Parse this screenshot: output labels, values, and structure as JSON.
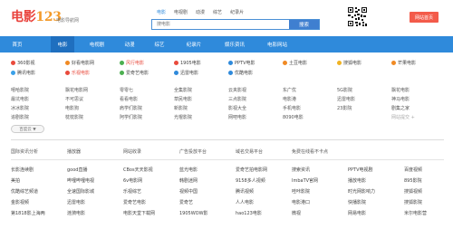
{
  "colors": {
    "brand_red": "#e9423c",
    "brand_orange": "#f39a2a",
    "nav_blue": "#2f8adb",
    "nav_active": "#1f6fbf",
    "search_btn": "#3f7fd0",
    "home_btn": "#f35b4a"
  },
  "header": {
    "logo_text": "电影",
    "logo_num": "123",
    "slogan": "电影导航网",
    "search_tabs": [
      "电影",
      "电视剧",
      "动漫",
      "综艺",
      "纪录片"
    ],
    "search_placeholder": "搜电影",
    "search_button": "搜索",
    "qr_icon": "qr-code-icon",
    "home_button": "网站首页"
  },
  "nav": {
    "items": [
      "首页",
      "电影",
      "电视剧",
      "动漫",
      "综艺",
      "纪录片",
      "娱乐资讯",
      "电影网站"
    ]
  },
  "featured": {
    "rows": [
      [
        {
          "label": "360影视",
          "icon": "#e94a3c",
          "style": ""
        },
        {
          "label": "好看电影网",
          "icon": "#f08a24",
          "style": ""
        },
        {
          "label": "风行电影",
          "icon": "#4caf50",
          "style": "hl"
        },
        {
          "label": "1905电影",
          "icon": "#e94a3c",
          "style": ""
        },
        {
          "label": "PPTV电影",
          "icon": "#2f8adb",
          "style": ""
        },
        {
          "label": "土豆电影",
          "icon": "#f08a24",
          "style": ""
        },
        {
          "label": "搜狐电影",
          "icon": "#f0b323",
          "style": ""
        },
        {
          "label": "芒果电影",
          "icon": "#f08a24",
          "style": ""
        }
      ],
      [
        {
          "label": "腾讯电影",
          "icon": "#3aa0e8",
          "style": ""
        },
        {
          "label": "乐视电影",
          "icon": "#e94a3c",
          "style": "hl"
        },
        {
          "label": "爱奇艺电影",
          "icon": "#4caf50",
          "style": ""
        },
        {
          "label": "迅雷电影",
          "icon": "#2f8adb",
          "style": ""
        },
        {
          "label": "优酷电影",
          "icon": "#2f8adb",
          "style": ""
        }
      ]
    ],
    "grid": [
      [
        "嘻哈影院",
        "飘花电影网",
        "零零七",
        "全集影院",
        "云夹影视",
        "东广优",
        "5G影院",
        "飘花电影"
      ],
      [
        "最坑电影",
        "不可思议",
        "看看电影",
        "草民电影",
        "三点影院",
        "电影港",
        "迅雷电影",
        "神马电影"
      ],
      [
        "冰冰影院",
        "电影狗",
        "肩学们影院",
        "新影院",
        "影视大全",
        "手机电影",
        "23影院",
        "剧集之家"
      ],
      [
        "追剧影院",
        "枕枕影院",
        "阿学们影院",
        "光棍影院",
        "网吧电影",
        "8090电影",
        "网站提交 +",
        ""
      ]
    ],
    "more_button": "百度云 ▼"
  },
  "categories": [
    "国际资讯分析",
    "播放器",
    "网站收录",
    "广告投放平台",
    "域名交易平台",
    "免费在线看不卡点"
  ],
  "links": [
    [
      "长影连续剧",
      "good直播",
      "CBos天天影视",
      "蓝光电影",
      "爱奇艺拍电影网",
      "搜索资讯",
      "PPTV电视剧",
      "百度视频"
    ],
    [
      "美拍",
      "哔哩哔哩电视",
      "6v电影网",
      "韩剧迷网",
      "9158多人视频",
      "ImbaTV官网",
      "播放电影",
      "895影院"
    ],
    [
      "优酷综艺频道",
      "全速国际影城",
      "乐视综艺",
      "视频中国",
      "腾讯视频",
      "哇咔影院",
      "时光网影响力",
      "搜狐视频"
    ],
    [
      "金影视频",
      "迅雷电影",
      "爱奇艺电影",
      "爱奇艺",
      "人人电影",
      "电影港口",
      "快播影院",
      "搜狐影院"
    ],
    [
      "第1818影上海两",
      "涟漪电影",
      "电影天堂下载网",
      "1905WOW影",
      "hao123电影",
      "微视",
      "网易电影",
      "米尔电影营"
    ]
  ]
}
